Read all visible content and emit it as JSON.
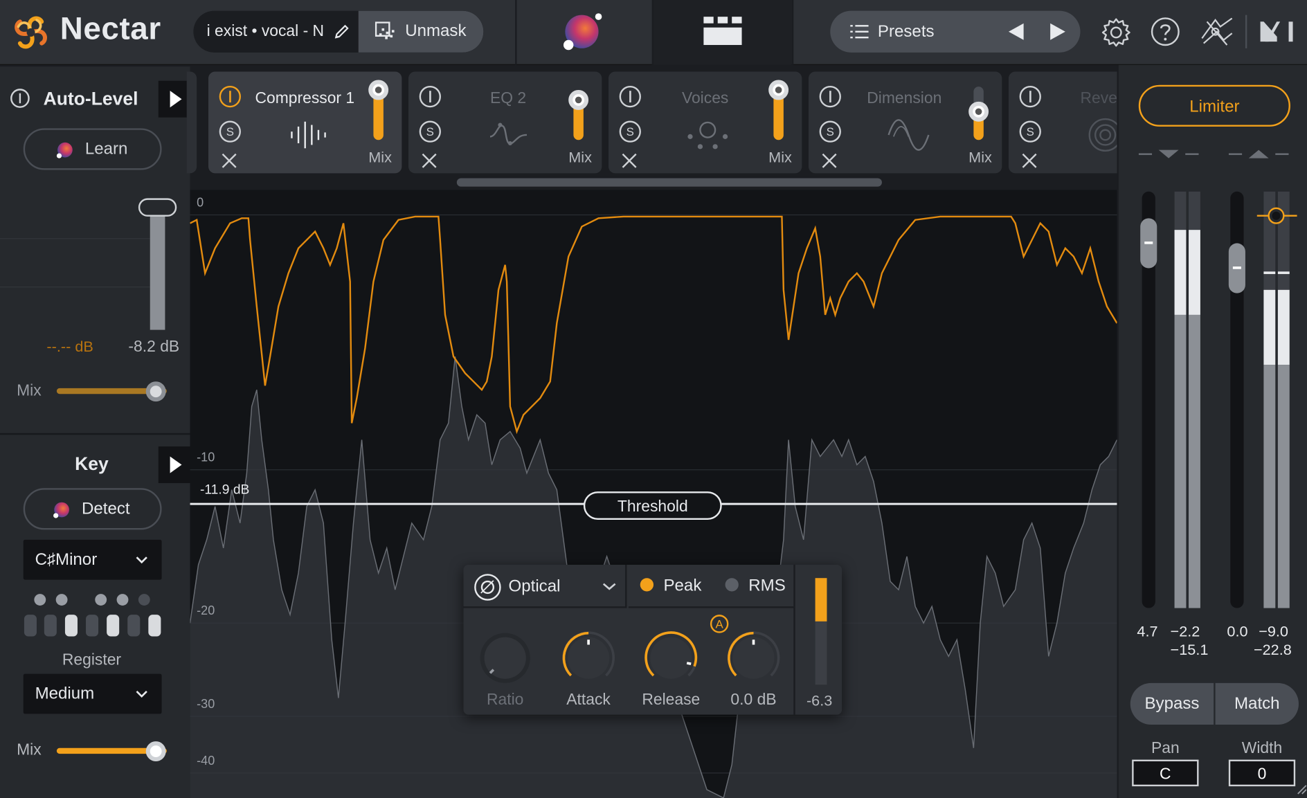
{
  "app": {
    "name": "Nectar"
  },
  "header": {
    "preset_name": "i exist • vocal - N",
    "unmask_label": "Unmask",
    "presets_label": "Presets"
  },
  "auto_level": {
    "title": "Auto-Level",
    "learn_label": "Learn",
    "left_value": "--.-- dB",
    "right_value": "-8.2 dB",
    "mix_label": "Mix"
  },
  "key": {
    "title": "Key",
    "detect_label": "Detect",
    "key_value": "C♯Minor",
    "register_label": "Register",
    "register_value": "Medium",
    "mix_label": "Mix"
  },
  "modules": [
    {
      "name": "Compressor 1",
      "mix_label": "Mix",
      "active": true
    },
    {
      "name": "EQ 2",
      "mix_label": "Mix",
      "active": false
    },
    {
      "name": "Voices",
      "mix_label": "Mix",
      "active": false
    },
    {
      "name": "Dimension",
      "mix_label": "Mix",
      "active": false
    },
    {
      "name": "Reverb",
      "active": false
    }
  ],
  "graph": {
    "db_labels": [
      "0",
      "-10",
      "-20",
      "-30",
      "-40"
    ],
    "threshold_value": "-11.9 dB",
    "threshold_label": "Threshold"
  },
  "compressor": {
    "mode": "Optical",
    "detection": {
      "peak": "Peak",
      "rms": "RMS",
      "selected": "Peak"
    },
    "auto_badge": "A",
    "knobs": [
      {
        "label": "Ratio",
        "enabled": false
      },
      {
        "label": "Attack",
        "enabled": true
      },
      {
        "label": "Release",
        "enabled": true
      },
      {
        "label": "0.0 dB",
        "enabled": true
      }
    ],
    "gain_reduction": "-6.3"
  },
  "limiter": {
    "label": "Limiter",
    "input_gain": "4.7",
    "input_peak": "−2.2",
    "input_rms": "−15.1",
    "output_gain": "0.0",
    "output_peak": "−9.0",
    "output_rms": "−22.8",
    "bypass_label": "Bypass",
    "match_label": "Match",
    "pan_label": "Pan",
    "pan_value": "C",
    "width_label": "Width",
    "width_value": "0"
  },
  "colors": {
    "accent": "#f3a11b",
    "background": "#1b1d21",
    "panel": "#2d3035"
  }
}
